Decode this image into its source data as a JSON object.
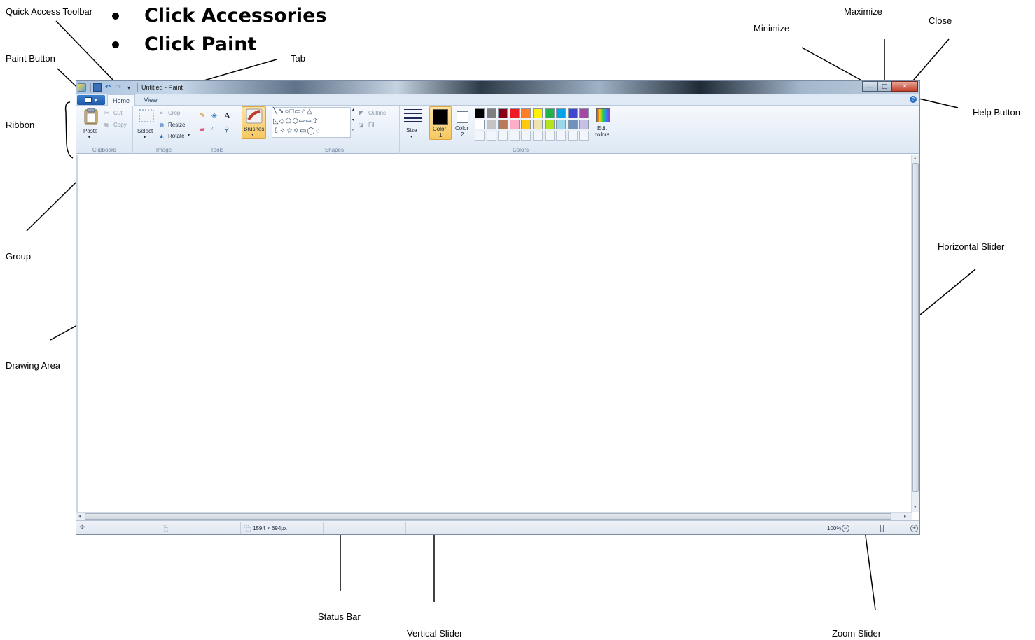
{
  "instructions": [
    "Click Accessories",
    "Click Paint"
  ],
  "annotations": {
    "quick_access_toolbar": "Quick Access Toolbar",
    "paint_button": "Paint Button",
    "ribbon": "Ribbon",
    "group": "Group",
    "drawing_area": "Drawing Area",
    "tab": "Tab",
    "minimize": "Minimize",
    "maximize": "Maximize",
    "close": "Close",
    "help_button": "Help Button",
    "horizontal_slider": "Horizontal Slider",
    "status_bar": "Status Bar",
    "vertical_slider": "Vertical Slider",
    "zoom_slider": "Zoom Slider"
  },
  "window": {
    "title": "Untitled - Paint",
    "tabs": [
      "Home",
      "View"
    ]
  },
  "ribbon": {
    "clipboard": {
      "label": "Clipboard",
      "paste": "Paste",
      "cut": "Cut",
      "copy": "Copy"
    },
    "image": {
      "label": "Image",
      "select": "Select",
      "crop": "Crop",
      "resize": "Resize",
      "rotate": "Rotate"
    },
    "tools": {
      "label": "Tools"
    },
    "brushes": {
      "label": "Brushes"
    },
    "shapes": {
      "label": "Shapes",
      "outline": "Outline",
      "fill": "Fill"
    },
    "size": {
      "label": "Size"
    },
    "colors": {
      "label": "Colors",
      "color1": "Color",
      "color1_num": "1",
      "color2": "Color",
      "color2_num": "2",
      "edit": "Edit",
      "edit2": "colors",
      "palette_row1": [
        "#000000",
        "#7f7f7f",
        "#880015",
        "#ed1c24",
        "#ff7f27",
        "#fff200",
        "#22b14c",
        "#00a2e8",
        "#3f48cc",
        "#a349a4"
      ],
      "palette_row2": [
        "#ffffff",
        "#c3c3c3",
        "#b97a57",
        "#ffaec9",
        "#ffc90e",
        "#efe4b0",
        "#b5e61d",
        "#99d9ea",
        "#7092be",
        "#c8bfe7"
      ]
    }
  },
  "status": {
    "dimensions": "1594 × 694px",
    "zoom": "100%"
  }
}
